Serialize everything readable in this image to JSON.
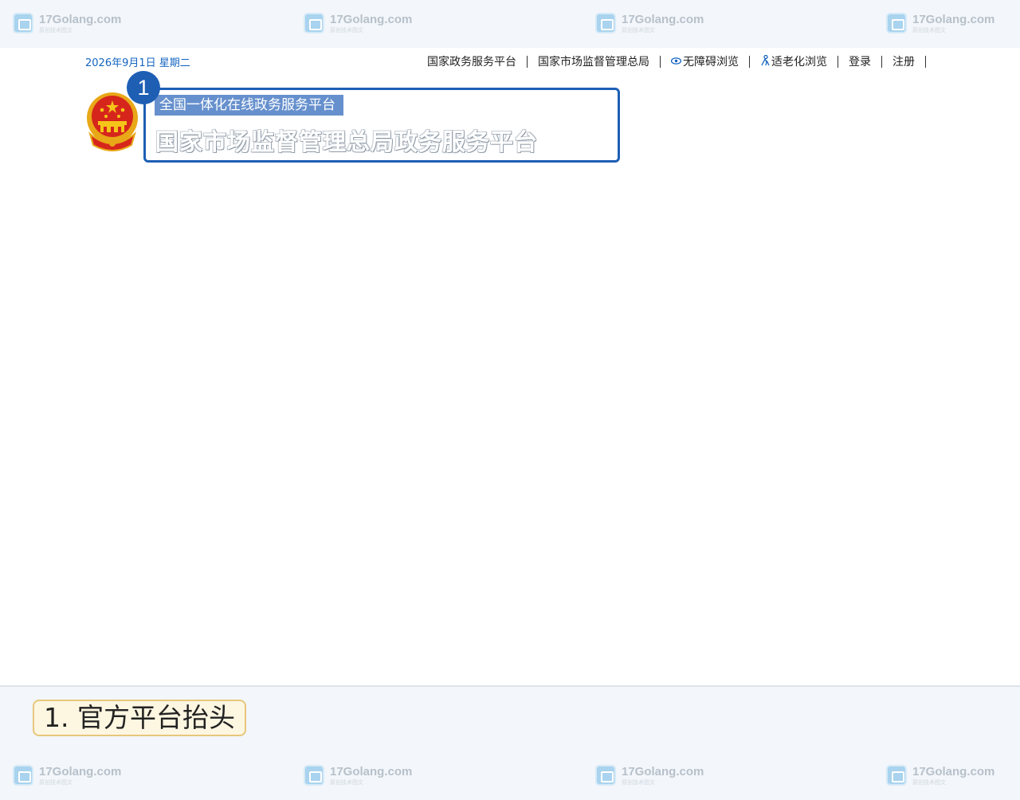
{
  "watermark": {
    "name": "17Golang.com",
    "tagline": "原创技术图文"
  },
  "header": {
    "date": "2026年9月1日 星期二",
    "nav": [
      {
        "label": "国家政务服务平台"
      },
      {
        "label": "国家市场监督管理总局"
      },
      {
        "label": "无障碍浏览",
        "icon": "eye-icon"
      },
      {
        "label": "适老化浏览",
        "icon": "elder-icon"
      },
      {
        "label": "登录"
      },
      {
        "label": "注册"
      }
    ]
  },
  "banner": {
    "emblem": "national-emblem-icon",
    "step_number": "1",
    "subtitle": "全国一体化在线政务服务平台",
    "title": "国家市场监督管理总局政务服务平台"
  },
  "caption": {
    "label": "1. 官方平台抬头"
  },
  "colors": {
    "accent_blue": "#1e5fb4",
    "subtitle_bg": "#6690cd",
    "label_border": "#e6c77c",
    "label_bg": "#fdf6e1"
  }
}
